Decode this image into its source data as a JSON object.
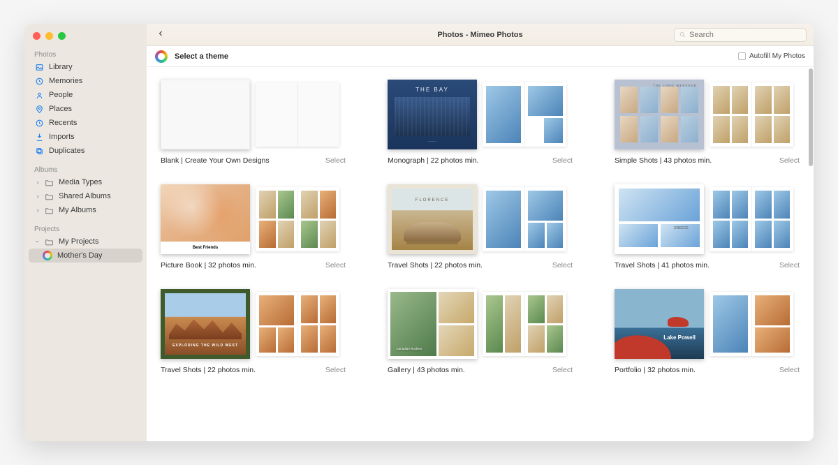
{
  "window_title": "Photos - Mimeo Photos",
  "search": {
    "placeholder": "Search"
  },
  "subbar": {
    "title": "Select a theme",
    "autofill_label": "Autofill My Photos"
  },
  "sidebar": {
    "sections": {
      "photos": {
        "header": "Photos",
        "items": [
          "Library",
          "Memories",
          "People",
          "Places",
          "Recents",
          "Imports",
          "Duplicates"
        ]
      },
      "albums": {
        "header": "Albums",
        "items": [
          "Media Types",
          "Shared Albums",
          "My Albums"
        ]
      },
      "projects": {
        "header": "Projects",
        "root": "My Projects",
        "selected": "Mother's Day"
      }
    }
  },
  "themes": [
    {
      "label": "Blank | Create Your Own Designs",
      "select": "Select",
      "cover_title": ""
    },
    {
      "label": "Monograph | 22 photos min.",
      "select": "Select",
      "cover_title": "THE BAY"
    },
    {
      "label": "Simple Shots | 43 photos min.",
      "select": "Select",
      "cover_title": "THE LONG WEEKEND"
    },
    {
      "label": "Picture Book | 32 photos min.",
      "select": "Select",
      "cover_title": "Best Friends"
    },
    {
      "label": "Travel Shots | 22 photos min.",
      "select": "Select",
      "cover_title": "FLORENCE"
    },
    {
      "label": "Travel Shots | 41 photos min.",
      "select": "Select",
      "cover_title": "GREECE"
    },
    {
      "label": "Travel Shots | 22 photos min.",
      "select": "Select",
      "cover_title": "EXPLORING THE WILD WEST"
    },
    {
      "label": "Gallery | 43 photos min.",
      "select": "Select",
      "cover_title": "Canadian Rockies"
    },
    {
      "label": "Portfolio | 32 photos min.",
      "select": "Select",
      "cover_title": "Lake Powell"
    }
  ]
}
